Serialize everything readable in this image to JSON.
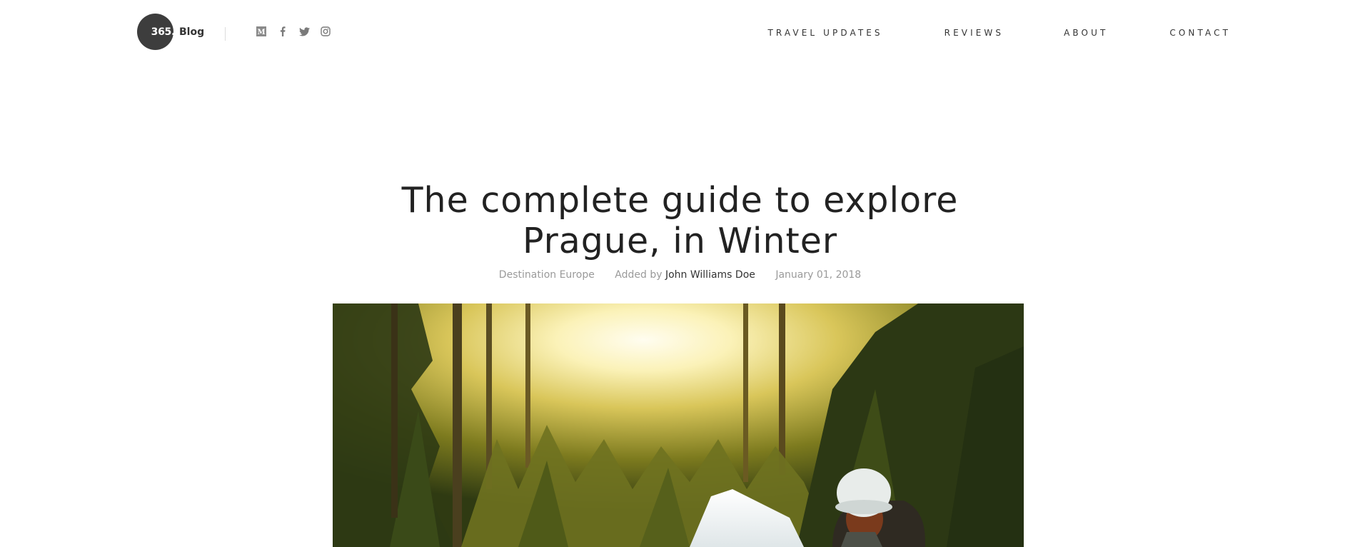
{
  "header": {
    "logo": {
      "number": "365.",
      "text": "Blog"
    },
    "socials": [
      {
        "name": "medium",
        "icon": "medium-icon"
      },
      {
        "name": "facebook",
        "icon": "facebook-icon"
      },
      {
        "name": "twitter",
        "icon": "twitter-icon"
      },
      {
        "name": "instagram",
        "icon": "instagram-icon"
      }
    ],
    "nav": [
      "TRAVEL UPDATES",
      "REVIEWS",
      "ABOUT",
      "CONTACT"
    ]
  },
  "article": {
    "title_line1": "The complete guide to explore",
    "title_line2": "Prague, in Winter",
    "category": "Destination Europe",
    "added_by_label": "Added by",
    "author": "John Williams Doe",
    "date": "January 01, 2018"
  },
  "colors": {
    "logo_bg": "#3d3d3d",
    "text": "#222222",
    "muted": "#9a9a9a"
  }
}
